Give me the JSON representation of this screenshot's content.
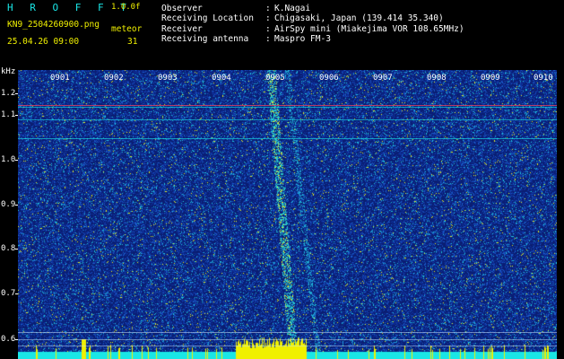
{
  "header": {
    "app_title": "H R O F F T",
    "version": "1.0.0f",
    "filename": "KN9_2504260900.png",
    "datetime": "25.04.26 09:00",
    "meteor_label": "meteor",
    "meteor_count": "31"
  },
  "info": {
    "labels": [
      "Observer",
      "Receiving Location",
      "Receiver",
      "Receiving antenna"
    ],
    "values": [
      "K.Nagai",
      "Chigasaki, Japan (139.414 35.340)",
      "AirSpy mini (Miakejima VOR 108.65MHz)",
      "Maspro FM-3"
    ]
  },
  "axis": {
    "unit": "kHz",
    "y_labels": [
      "1.2",
      "1.1",
      "1.0",
      "0.9",
      "0.8",
      "0.7",
      "0.6"
    ],
    "x_labels": [
      "0901",
      "0902",
      "0903",
      "0904",
      "0905",
      "0906",
      "0907",
      "0908",
      "0909",
      "0910"
    ]
  },
  "colors": {
    "background": "#0a1f73",
    "noise_hi": "#19e6e6",
    "signal": "#f0f000",
    "carrier": "#e04060"
  }
}
